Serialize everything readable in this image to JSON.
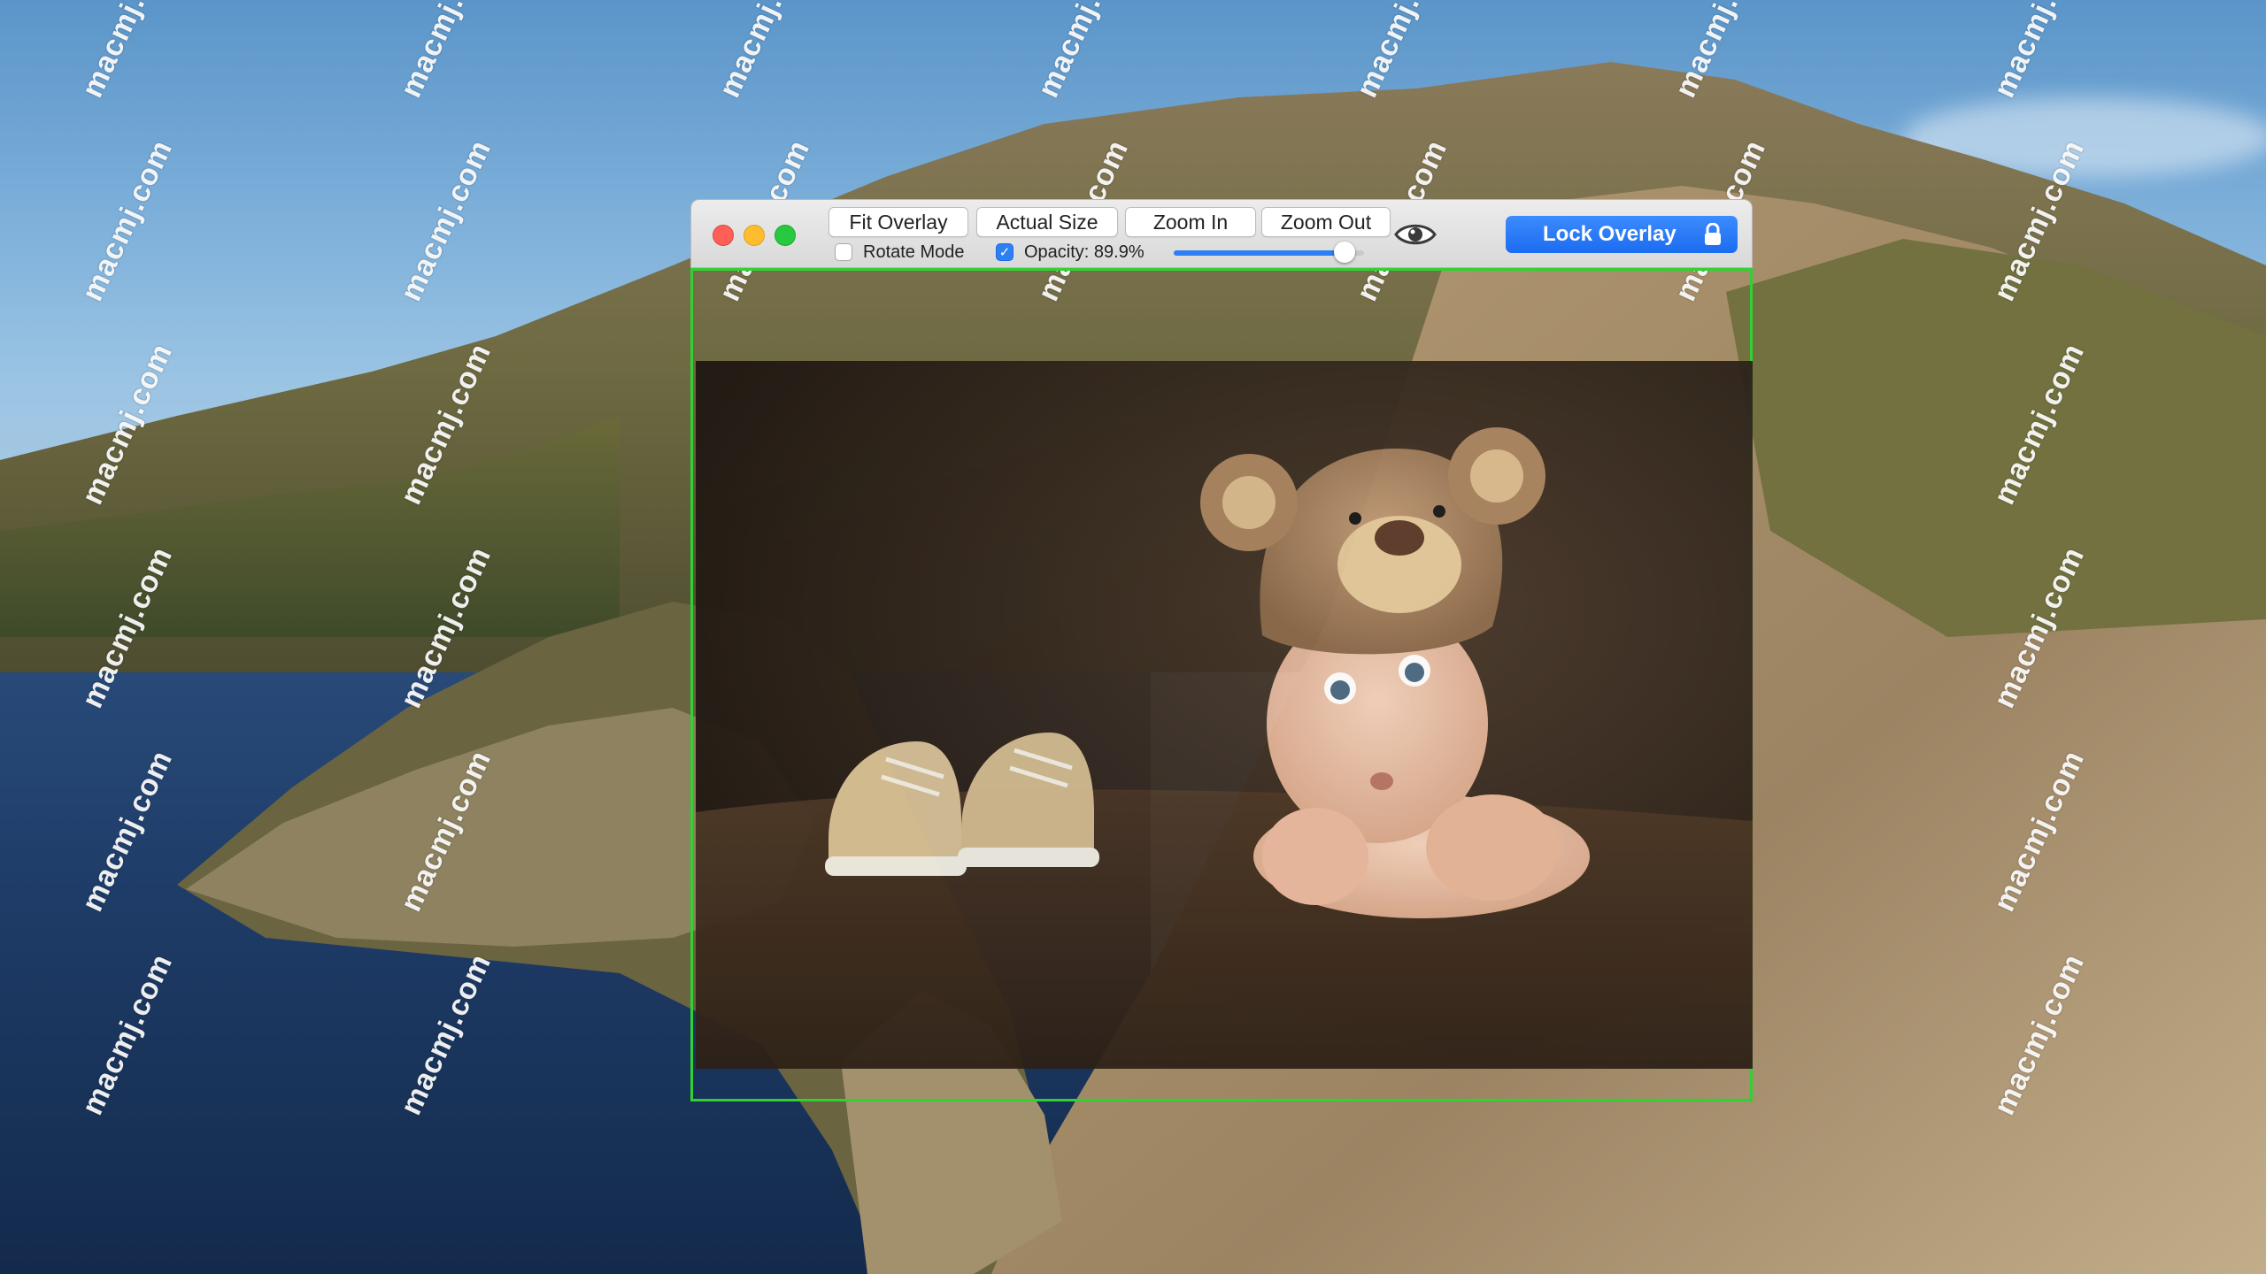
{
  "watermark": {
    "text": "macmj.com"
  },
  "window": {
    "toolbar": {
      "fit_overlay": "Fit Overlay",
      "actual_size": "Actual Size",
      "zoom_in": "Zoom In",
      "zoom_out": "Zoom Out",
      "rotate_mode_label": "Rotate Mode",
      "rotate_mode_checked": false,
      "opacity_checked": true,
      "opacity_label": "Opacity: 89.9%",
      "opacity_value": 0.899,
      "lock_overlay": "Lock Overlay"
    },
    "icons": {
      "visibility": "eye-icon",
      "lock": "lock-icon"
    },
    "colors": {
      "overlay_border": "#31d133",
      "accent": "#2d7ff5"
    }
  }
}
